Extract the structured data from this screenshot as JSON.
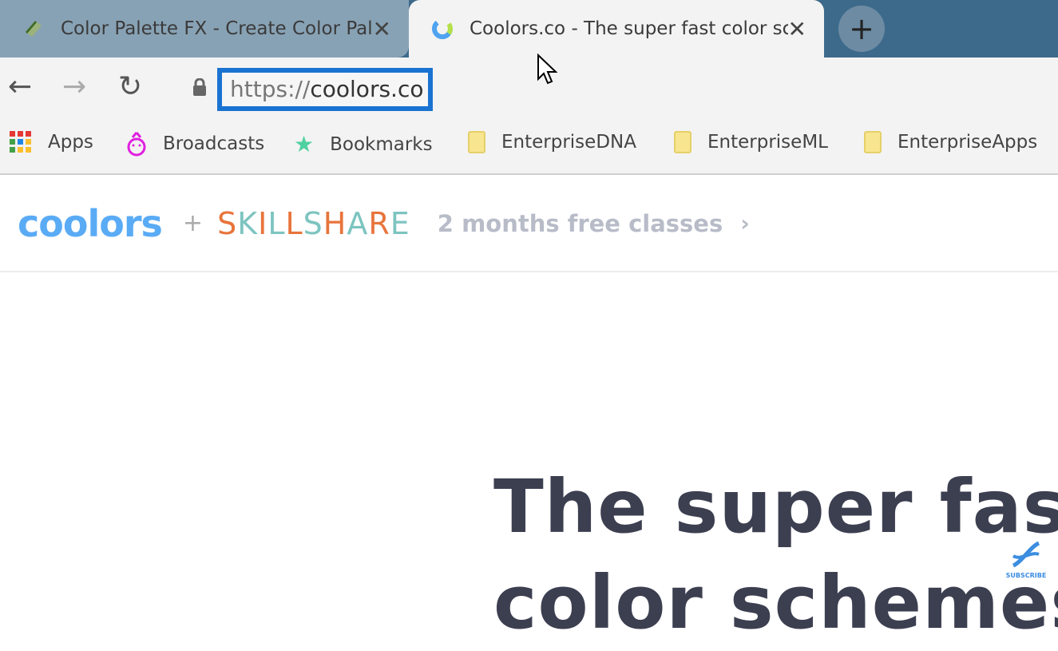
{
  "tabs": [
    {
      "title": "Color Palette FX - Create Color Palettes",
      "active": false,
      "icon": "palette-favicon"
    },
    {
      "title": "Coolors.co - The super fast color schemes generator",
      "active": true,
      "icon": "coolors-favicon"
    }
  ],
  "new_tab_label": "+",
  "close_label": "✕",
  "toolbar": {
    "back": "←",
    "forward": "→",
    "reload": "↻",
    "url_scheme": "https://",
    "url_host": "coolors.co",
    "highlight_color": "#1a73d1"
  },
  "bookmarks": [
    {
      "label": "Apps",
      "icon": "apps-grid-icon"
    },
    {
      "label": "Broadcasts",
      "icon": "broadcasts-icon"
    },
    {
      "label": "Bookmarks",
      "icon": "star-icon"
    },
    {
      "label": "EnterpriseDNA",
      "icon": "folder-icon"
    },
    {
      "label": "EnterpriseML",
      "icon": "folder-icon"
    },
    {
      "label": "EnterpriseApps",
      "icon": "folder-icon"
    }
  ],
  "banner": {
    "logo": "coolors",
    "plus": "+",
    "partner": "SKILLSHARE",
    "promo": "2 months free classes",
    "chevron": "›"
  },
  "hero": {
    "line1": "The super fast",
    "line2": "color schemes"
  },
  "overlay": {
    "subscribe": "SUBSCRIBE"
  }
}
